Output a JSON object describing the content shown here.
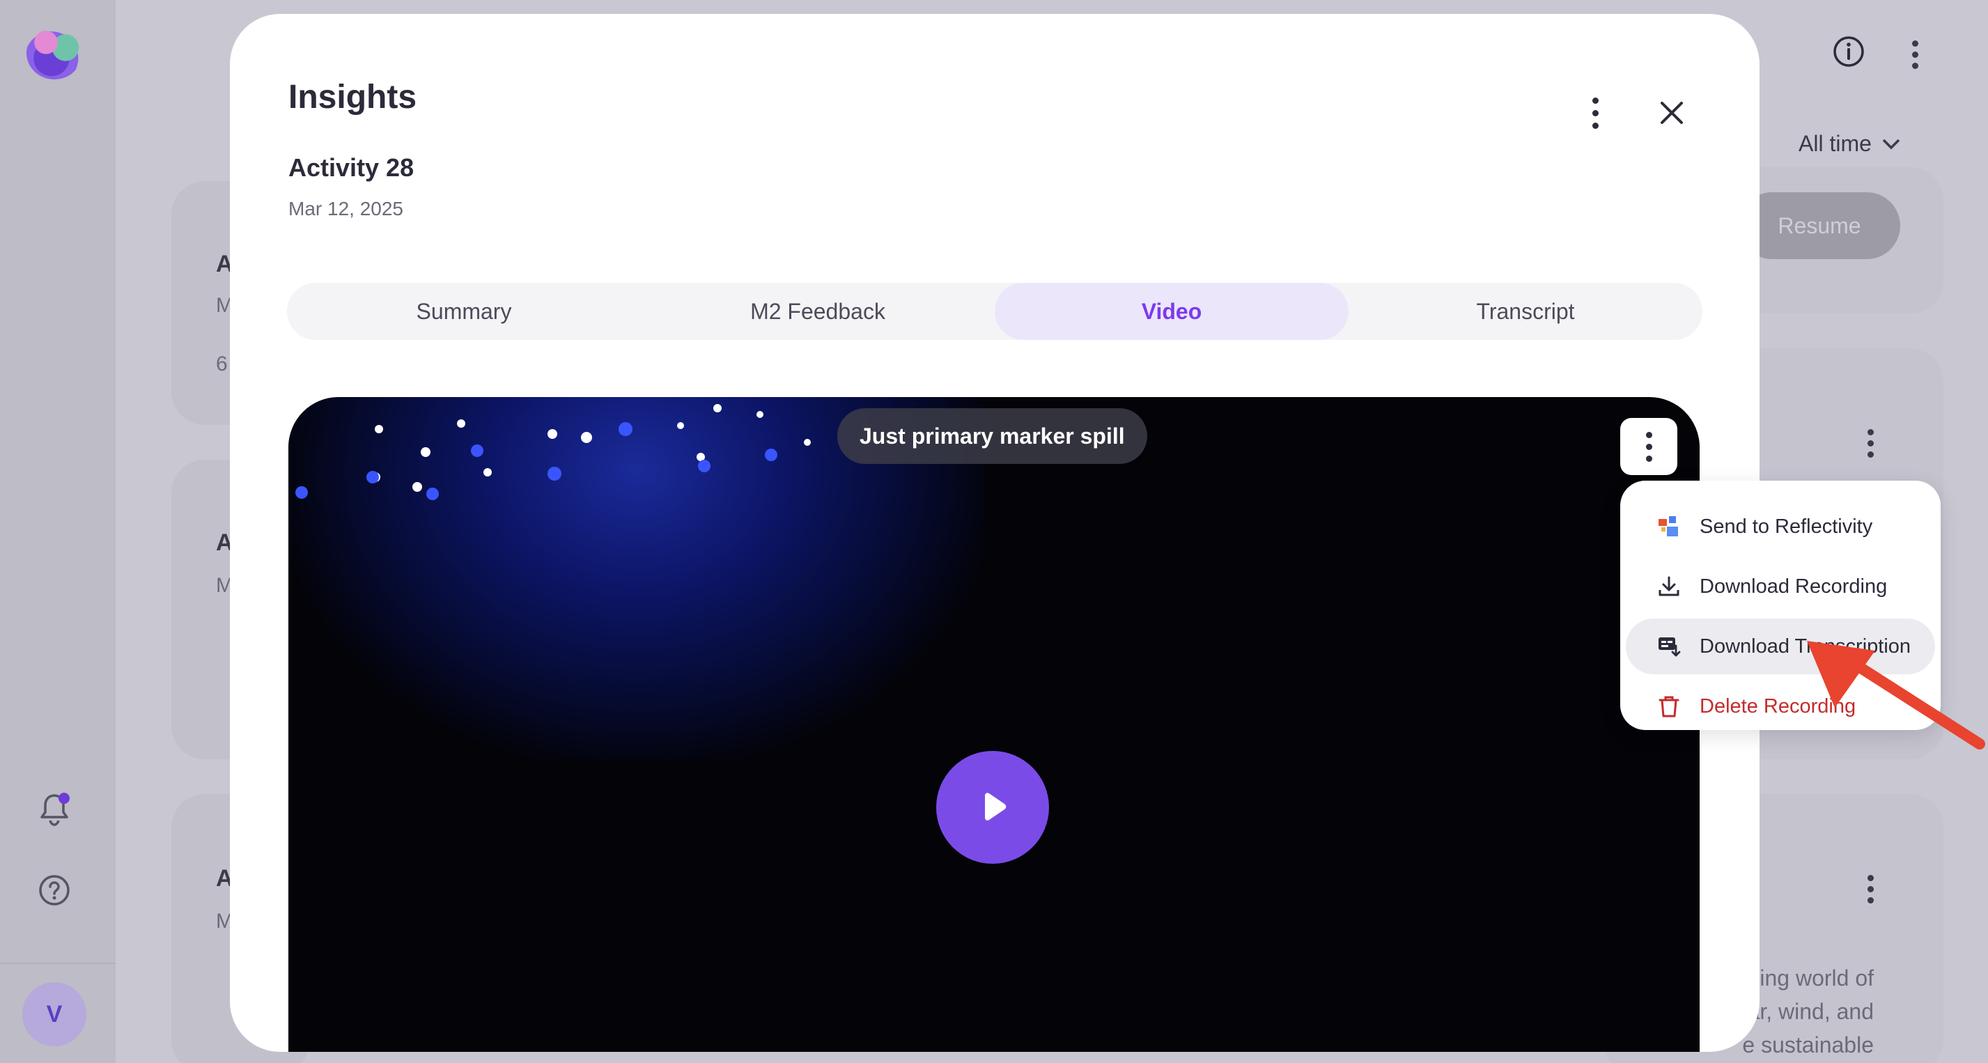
{
  "background": {
    "filter_label": "All time",
    "resume_label": "Resume",
    "partial_text": [
      "ing world of",
      "lar, wind, and",
      "e sustainable"
    ],
    "card_letters": [
      "A",
      "A",
      "A"
    ],
    "card_small": [
      "M",
      "6",
      "M",
      "M"
    ]
  },
  "modal": {
    "title": "Insights",
    "activity_title": "Activity 28",
    "activity_date": "Mar 12, 2025",
    "tabs": [
      {
        "label": "Summary",
        "active": false
      },
      {
        "label": "M2 Feedback",
        "active": false
      },
      {
        "label": "Video",
        "active": true
      },
      {
        "label": "Transcript",
        "active": false
      }
    ]
  },
  "video": {
    "title": "Just primary marker spill"
  },
  "menu": {
    "items": [
      {
        "label": "Send to Reflectivity",
        "icon": "reflectivity-logo-icon"
      },
      {
        "label": "Download Recording",
        "icon": "download-icon"
      },
      {
        "label": "Download Transcription",
        "icon": "download-transcript-icon"
      },
      {
        "label": "Delete Recording",
        "icon": "trash-icon"
      }
    ]
  },
  "colors": {
    "accent": "#7c3aed",
    "play": "#7b4be8",
    "danger": "#c42b2b",
    "annotation_arrow": "#e8442f"
  }
}
